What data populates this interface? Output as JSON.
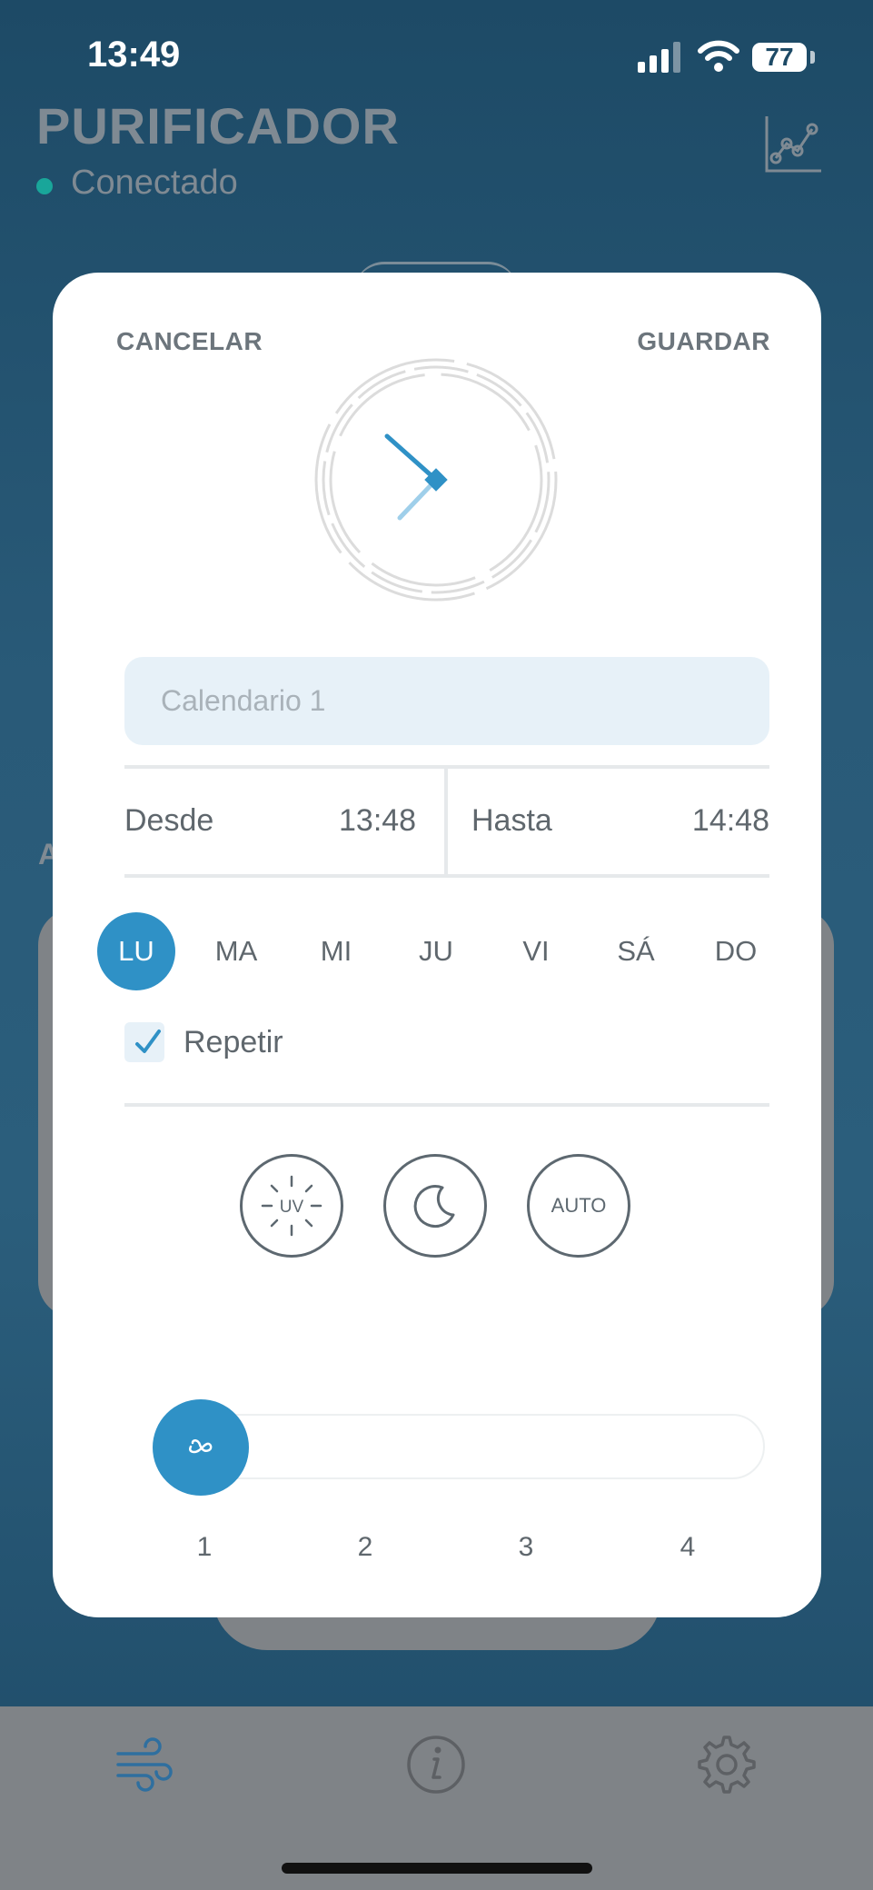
{
  "status_bar": {
    "time": "13:49",
    "battery": "77"
  },
  "header": {
    "title": "PURIFICADOR",
    "connection": "Conectado"
  },
  "background": {
    "section_letter": "A"
  },
  "modal": {
    "cancel_label": "CANCELAR",
    "save_label": "GUARDAR",
    "name_placeholder": "Calendario 1",
    "from_label": "Desde",
    "from_value": "13:48",
    "to_label": "Hasta",
    "to_value": "14:48",
    "days": [
      {
        "label": "LU",
        "active": true
      },
      {
        "label": "MA",
        "active": false
      },
      {
        "label": "MI",
        "active": false
      },
      {
        "label": "JU",
        "active": false
      },
      {
        "label": "VI",
        "active": false
      },
      {
        "label": "SÁ",
        "active": false
      },
      {
        "label": "DO",
        "active": false
      }
    ],
    "repeat_label": "Repetir",
    "repeat_checked": true,
    "modes": {
      "uv": "UV",
      "night": "moon-icon",
      "auto": "AUTO"
    },
    "fan_speed": {
      "value": 1,
      "ticks": [
        "1",
        "2",
        "3",
        "4"
      ]
    }
  },
  "tabs": [
    "fan-icon",
    "info-icon",
    "settings-icon"
  ],
  "colors": {
    "accent": "#2f91c6",
    "connected": "#19a69a",
    "text": "#5f676d"
  }
}
